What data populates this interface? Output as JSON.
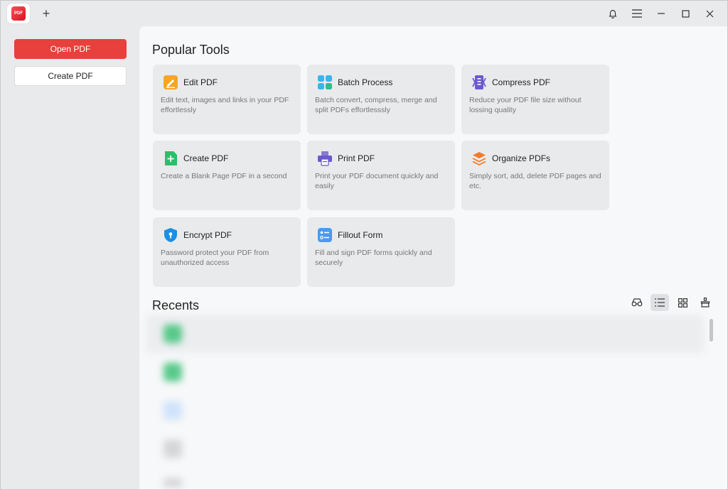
{
  "titlebar": {
    "logo_text": "PDF"
  },
  "sidebar": {
    "open_label": "Open PDF",
    "create_label": "Create PDF"
  },
  "main": {
    "tools_title": "Popular Tools",
    "recents_title": "Recents",
    "tools": [
      {
        "name": "Edit PDF",
        "desc": "Edit text, images and links in your PDF effortlessly"
      },
      {
        "name": "Batch Process",
        "desc": "Batch convert, compress, merge and split PDFs effortlesssly"
      },
      {
        "name": "Compress PDF",
        "desc": "Reduce your PDF file size without lossing quality"
      },
      {
        "name": "Create PDF",
        "desc": "Create a Blank Page PDF in a second"
      },
      {
        "name": "Print PDF",
        "desc": "Print your PDF document quickly and easily"
      },
      {
        "name": "Organize PDFs",
        "desc": "Simply sort, add, delete PDF pages and etc."
      },
      {
        "name": "Encrypt PDF",
        "desc": "Password protect your PDF from unauthorized access"
      },
      {
        "name": "Fillout Form",
        "desc": "Fill and sign PDF forms quickly and securely"
      }
    ]
  },
  "colors": {
    "accent": "#e8403c",
    "panel_bg": "#f7f8f9",
    "card_bg": "#e9eaec"
  }
}
